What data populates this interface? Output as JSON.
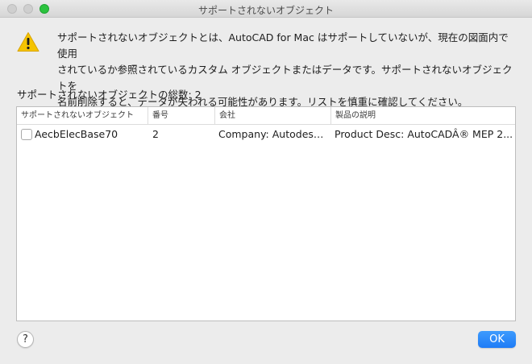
{
  "window": {
    "title": "サポートされないオブジェクト"
  },
  "message": {
    "line1": "サポートされないオブジェクトとは、AutoCAD for Mac はサポートしていないが、現在の図面内で使用",
    "line2": "されているか参照されているカスタム オブジェクトまたはデータです。サポートされないオブジェクトを",
    "line3": "名前削除すると、データが失われる可能性があります。リストを慎重に確認してください。"
  },
  "count_label": "サポートされないオブジェクトの総数: 2",
  "table": {
    "headers": [
      "サポートされないオブジェクト",
      "番号",
      "会社",
      "製品の説明"
    ],
    "rows": [
      {
        "name": "AecbElecBase70",
        "number": "2",
        "company": "Company: Autodesk,...",
        "description": "Product Desc: AutoCADÂ® MEP 2...",
        "checked": false
      }
    ]
  },
  "buttons": {
    "help": "?",
    "ok": "OK"
  },
  "icons": {
    "warning": "warning-icon"
  },
  "colors": {
    "accent": "#1f7cf6",
    "warning": "#f5c400"
  }
}
